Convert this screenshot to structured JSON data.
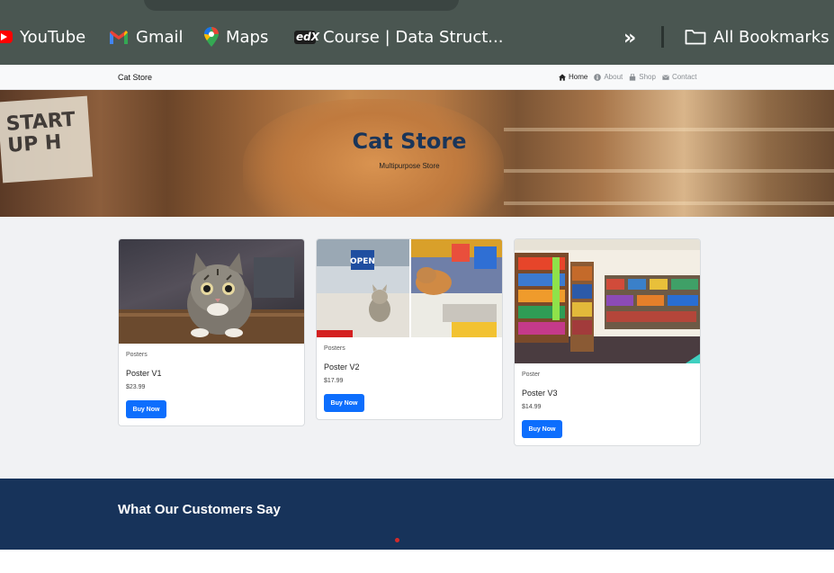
{
  "bookmarks": {
    "items": [
      {
        "label": "YouTube",
        "icon": "youtube-icon"
      },
      {
        "label": "Gmail",
        "icon": "gmail-icon"
      },
      {
        "label": "Maps",
        "icon": "maps-icon"
      },
      {
        "label": "Course | Data Struct...",
        "icon": "edx-icon"
      }
    ],
    "overflow_icon": "double-chevron-icon",
    "all_bookmarks_label": "All Bookmarks",
    "edx_text": "edX"
  },
  "navbar": {
    "brand": "Cat Store",
    "links": [
      {
        "label": "Home",
        "icon": "home-icon",
        "active": true
      },
      {
        "label": "About",
        "icon": "info-icon",
        "active": false
      },
      {
        "label": "Shop",
        "icon": "bag-icon",
        "active": false
      },
      {
        "label": "Contact",
        "icon": "envelope-icon",
        "active": false
      }
    ]
  },
  "hero": {
    "title": "Cat Store",
    "subtitle": "Multipurpose Store",
    "sign_text": "START\nUP H"
  },
  "products": [
    {
      "category": "Posters",
      "name": "Poster V1",
      "price": "$23.99",
      "button": "Buy Now"
    },
    {
      "category": "Posters",
      "name": "Poster V2",
      "price": "$17.99",
      "button": "Buy Now",
      "sign_text": "OPEN"
    },
    {
      "category": "Poster",
      "name": "Poster V3",
      "price": "$14.99",
      "button": "Buy Now"
    }
  ],
  "testimonials": {
    "title": "What Our Customers Say"
  },
  "colors": {
    "bookmark_bar": "#4a5651",
    "primary_button": "#0d6efd",
    "hero_title": "#1a3559",
    "testimonial_bg": "#17335a",
    "carousel_dot": "#d22b2b"
  }
}
